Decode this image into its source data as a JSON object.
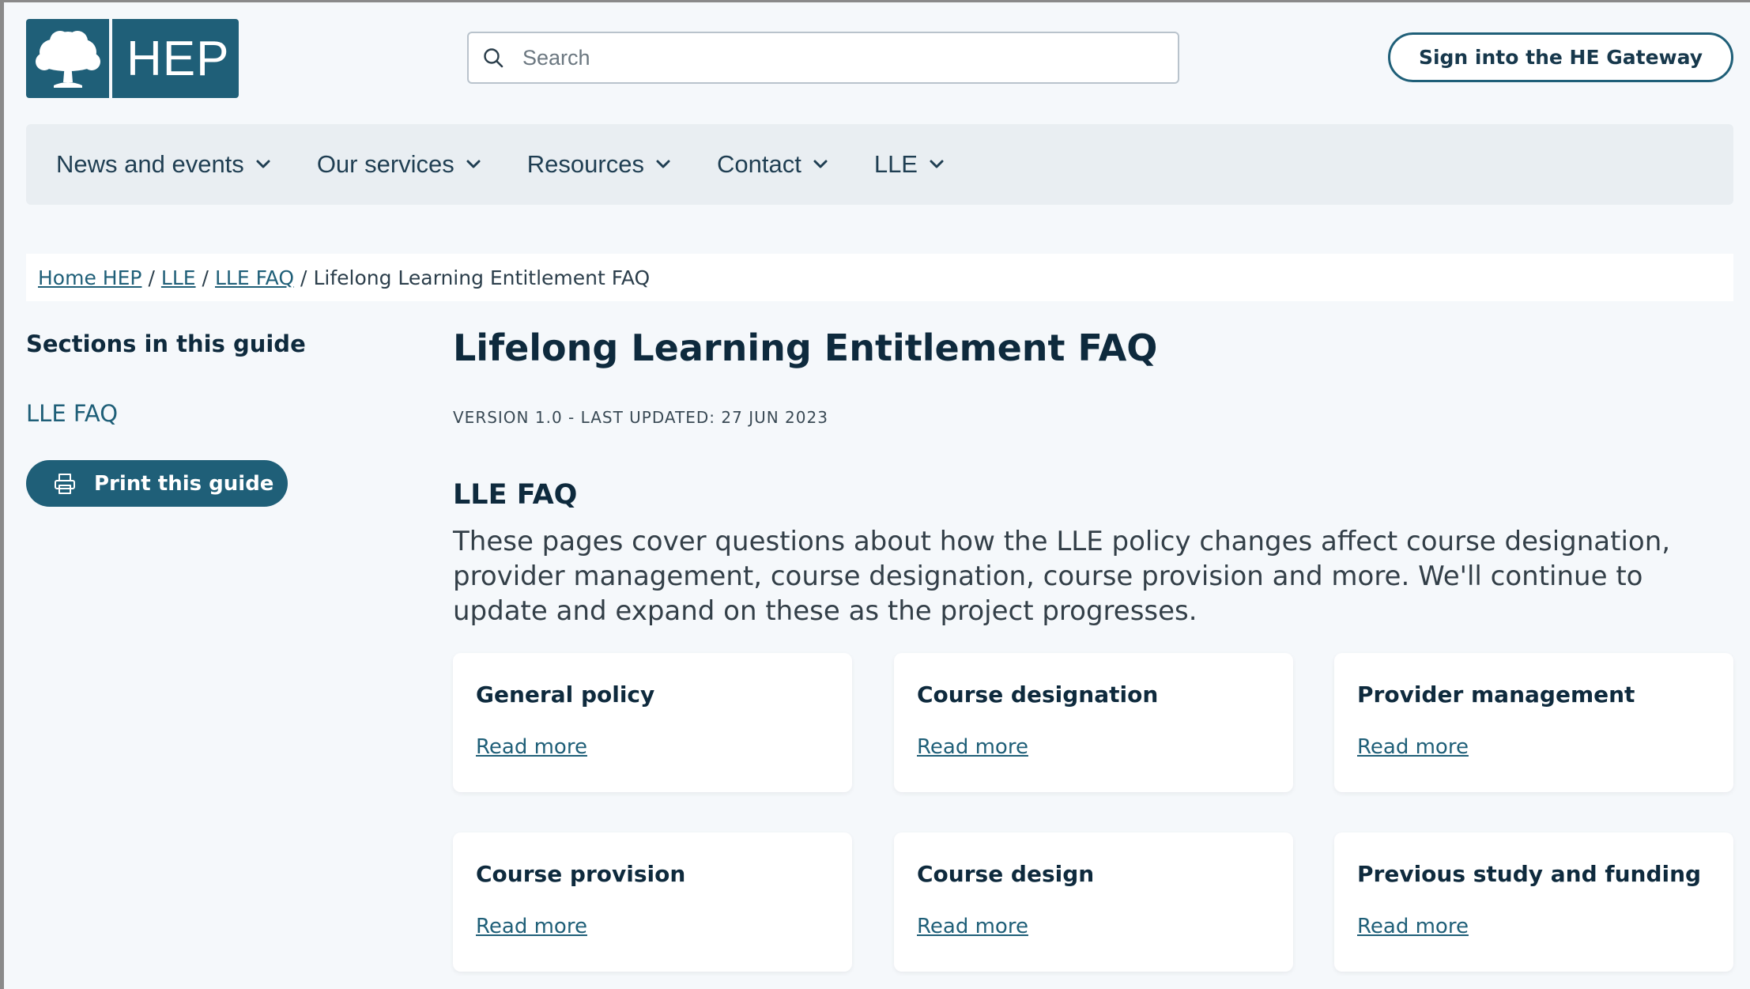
{
  "header": {
    "logo_text": "HEP",
    "search": {
      "placeholder": "Search"
    },
    "signin_label": "Sign into the HE Gateway"
  },
  "nav": {
    "items": [
      {
        "label": "News and events"
      },
      {
        "label": "Our services"
      },
      {
        "label": "Resources"
      },
      {
        "label": "Contact"
      },
      {
        "label": "LLE"
      }
    ]
  },
  "breadcrumb": {
    "items": [
      {
        "label": "Home HEP"
      },
      {
        "label": "LLE"
      },
      {
        "label": "LLE FAQ"
      }
    ],
    "current": "Lifelong Learning Entitlement FAQ",
    "separator": "/"
  },
  "sidebar": {
    "title": "Sections in this guide",
    "link": "LLE FAQ",
    "print_label": "Print this guide"
  },
  "main": {
    "title": "Lifelong Learning Entitlement FAQ",
    "version": "VERSION 1.0 - LAST UPDATED: 27 JUN 2023",
    "section_title": "LLE FAQ",
    "intro": "These pages cover questions about how the LLE policy changes affect course designation, provider management, course designation, course provision and more. We'll continue to update and expand on these as the project progresses.",
    "cards": [
      {
        "title": "General policy",
        "link": "Read more"
      },
      {
        "title": "Course designation",
        "link": "Read more"
      },
      {
        "title": "Provider management",
        "link": "Read more"
      },
      {
        "title": "Course provision",
        "link": "Read more"
      },
      {
        "title": "Course design",
        "link": "Read more"
      },
      {
        "title": "Previous study and funding",
        "link": "Read more"
      }
    ]
  },
  "colors": {
    "brand": "#1f5f78",
    "page_bg": "#f5f8fb",
    "nav_bg": "#e9eef2",
    "heading": "#0e2a3d"
  },
  "icons": [
    "tree-logo-icon",
    "search-icon",
    "chevron-down-icon",
    "printer-icon"
  ]
}
